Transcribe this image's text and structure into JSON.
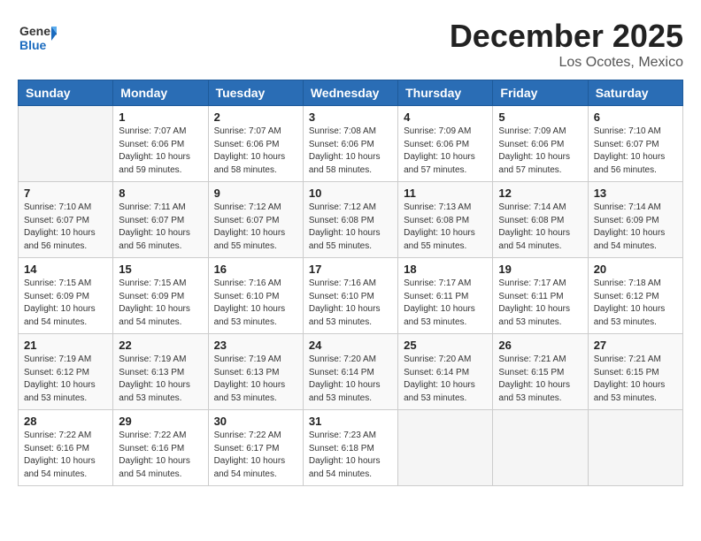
{
  "header": {
    "logo_general": "General",
    "logo_blue": "Blue",
    "month_title": "December 2025",
    "location": "Los Ocotes, Mexico"
  },
  "weekdays": [
    "Sunday",
    "Monday",
    "Tuesday",
    "Wednesday",
    "Thursday",
    "Friday",
    "Saturday"
  ],
  "weeks": [
    [
      {
        "day": "",
        "info": ""
      },
      {
        "day": "1",
        "info": "Sunrise: 7:07 AM\nSunset: 6:06 PM\nDaylight: 10 hours\nand 59 minutes."
      },
      {
        "day": "2",
        "info": "Sunrise: 7:07 AM\nSunset: 6:06 PM\nDaylight: 10 hours\nand 58 minutes."
      },
      {
        "day": "3",
        "info": "Sunrise: 7:08 AM\nSunset: 6:06 PM\nDaylight: 10 hours\nand 58 minutes."
      },
      {
        "day": "4",
        "info": "Sunrise: 7:09 AM\nSunset: 6:06 PM\nDaylight: 10 hours\nand 57 minutes."
      },
      {
        "day": "5",
        "info": "Sunrise: 7:09 AM\nSunset: 6:06 PM\nDaylight: 10 hours\nand 57 minutes."
      },
      {
        "day": "6",
        "info": "Sunrise: 7:10 AM\nSunset: 6:07 PM\nDaylight: 10 hours\nand 56 minutes."
      }
    ],
    [
      {
        "day": "7",
        "info": "Sunrise: 7:10 AM\nSunset: 6:07 PM\nDaylight: 10 hours\nand 56 minutes."
      },
      {
        "day": "8",
        "info": "Sunrise: 7:11 AM\nSunset: 6:07 PM\nDaylight: 10 hours\nand 56 minutes."
      },
      {
        "day": "9",
        "info": "Sunrise: 7:12 AM\nSunset: 6:07 PM\nDaylight: 10 hours\nand 55 minutes."
      },
      {
        "day": "10",
        "info": "Sunrise: 7:12 AM\nSunset: 6:08 PM\nDaylight: 10 hours\nand 55 minutes."
      },
      {
        "day": "11",
        "info": "Sunrise: 7:13 AM\nSunset: 6:08 PM\nDaylight: 10 hours\nand 55 minutes."
      },
      {
        "day": "12",
        "info": "Sunrise: 7:14 AM\nSunset: 6:08 PM\nDaylight: 10 hours\nand 54 minutes."
      },
      {
        "day": "13",
        "info": "Sunrise: 7:14 AM\nSunset: 6:09 PM\nDaylight: 10 hours\nand 54 minutes."
      }
    ],
    [
      {
        "day": "14",
        "info": "Sunrise: 7:15 AM\nSunset: 6:09 PM\nDaylight: 10 hours\nand 54 minutes."
      },
      {
        "day": "15",
        "info": "Sunrise: 7:15 AM\nSunset: 6:09 PM\nDaylight: 10 hours\nand 54 minutes."
      },
      {
        "day": "16",
        "info": "Sunrise: 7:16 AM\nSunset: 6:10 PM\nDaylight: 10 hours\nand 53 minutes."
      },
      {
        "day": "17",
        "info": "Sunrise: 7:16 AM\nSunset: 6:10 PM\nDaylight: 10 hours\nand 53 minutes."
      },
      {
        "day": "18",
        "info": "Sunrise: 7:17 AM\nSunset: 6:11 PM\nDaylight: 10 hours\nand 53 minutes."
      },
      {
        "day": "19",
        "info": "Sunrise: 7:17 AM\nSunset: 6:11 PM\nDaylight: 10 hours\nand 53 minutes."
      },
      {
        "day": "20",
        "info": "Sunrise: 7:18 AM\nSunset: 6:12 PM\nDaylight: 10 hours\nand 53 minutes."
      }
    ],
    [
      {
        "day": "21",
        "info": "Sunrise: 7:19 AM\nSunset: 6:12 PM\nDaylight: 10 hours\nand 53 minutes."
      },
      {
        "day": "22",
        "info": "Sunrise: 7:19 AM\nSunset: 6:13 PM\nDaylight: 10 hours\nand 53 minutes."
      },
      {
        "day": "23",
        "info": "Sunrise: 7:19 AM\nSunset: 6:13 PM\nDaylight: 10 hours\nand 53 minutes."
      },
      {
        "day": "24",
        "info": "Sunrise: 7:20 AM\nSunset: 6:14 PM\nDaylight: 10 hours\nand 53 minutes."
      },
      {
        "day": "25",
        "info": "Sunrise: 7:20 AM\nSunset: 6:14 PM\nDaylight: 10 hours\nand 53 minutes."
      },
      {
        "day": "26",
        "info": "Sunrise: 7:21 AM\nSunset: 6:15 PM\nDaylight: 10 hours\nand 53 minutes."
      },
      {
        "day": "27",
        "info": "Sunrise: 7:21 AM\nSunset: 6:15 PM\nDaylight: 10 hours\nand 53 minutes."
      }
    ],
    [
      {
        "day": "28",
        "info": "Sunrise: 7:22 AM\nSunset: 6:16 PM\nDaylight: 10 hours\nand 54 minutes."
      },
      {
        "day": "29",
        "info": "Sunrise: 7:22 AM\nSunset: 6:16 PM\nDaylight: 10 hours\nand 54 minutes."
      },
      {
        "day": "30",
        "info": "Sunrise: 7:22 AM\nSunset: 6:17 PM\nDaylight: 10 hours\nand 54 minutes."
      },
      {
        "day": "31",
        "info": "Sunrise: 7:23 AM\nSunset: 6:18 PM\nDaylight: 10 hours\nand 54 minutes."
      },
      {
        "day": "",
        "info": ""
      },
      {
        "day": "",
        "info": ""
      },
      {
        "day": "",
        "info": ""
      }
    ]
  ]
}
